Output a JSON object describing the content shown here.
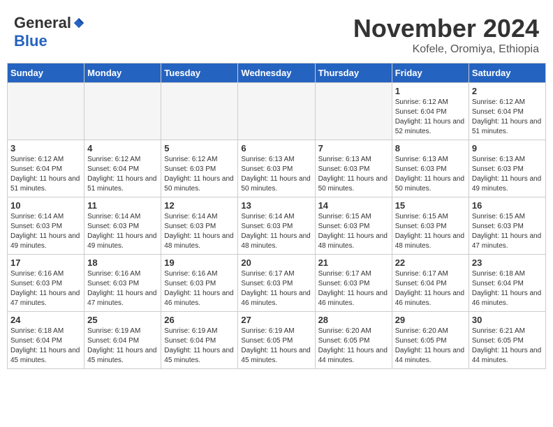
{
  "header": {
    "logo_general": "General",
    "logo_blue": "Blue",
    "month_title": "November 2024",
    "location": "Kofele, Oromiya, Ethiopia"
  },
  "calendar": {
    "weekdays": [
      "Sunday",
      "Monday",
      "Tuesday",
      "Wednesday",
      "Thursday",
      "Friday",
      "Saturday"
    ],
    "weeks": [
      [
        {
          "day": "",
          "empty": true
        },
        {
          "day": "",
          "empty": true
        },
        {
          "day": "",
          "empty": true
        },
        {
          "day": "",
          "empty": true
        },
        {
          "day": "",
          "empty": true
        },
        {
          "day": "1",
          "sunrise": "Sunrise: 6:12 AM",
          "sunset": "Sunset: 6:04 PM",
          "daylight": "Daylight: 11 hours and 52 minutes."
        },
        {
          "day": "2",
          "sunrise": "Sunrise: 6:12 AM",
          "sunset": "Sunset: 6:04 PM",
          "daylight": "Daylight: 11 hours and 51 minutes."
        }
      ],
      [
        {
          "day": "3",
          "sunrise": "Sunrise: 6:12 AM",
          "sunset": "Sunset: 6:04 PM",
          "daylight": "Daylight: 11 hours and 51 minutes."
        },
        {
          "day": "4",
          "sunrise": "Sunrise: 6:12 AM",
          "sunset": "Sunset: 6:04 PM",
          "daylight": "Daylight: 11 hours and 51 minutes."
        },
        {
          "day": "5",
          "sunrise": "Sunrise: 6:12 AM",
          "sunset": "Sunset: 6:03 PM",
          "daylight": "Daylight: 11 hours and 50 minutes."
        },
        {
          "day": "6",
          "sunrise": "Sunrise: 6:13 AM",
          "sunset": "Sunset: 6:03 PM",
          "daylight": "Daylight: 11 hours and 50 minutes."
        },
        {
          "day": "7",
          "sunrise": "Sunrise: 6:13 AM",
          "sunset": "Sunset: 6:03 PM",
          "daylight": "Daylight: 11 hours and 50 minutes."
        },
        {
          "day": "8",
          "sunrise": "Sunrise: 6:13 AM",
          "sunset": "Sunset: 6:03 PM",
          "daylight": "Daylight: 11 hours and 50 minutes."
        },
        {
          "day": "9",
          "sunrise": "Sunrise: 6:13 AM",
          "sunset": "Sunset: 6:03 PM",
          "daylight": "Daylight: 11 hours and 49 minutes."
        }
      ],
      [
        {
          "day": "10",
          "sunrise": "Sunrise: 6:14 AM",
          "sunset": "Sunset: 6:03 PM",
          "daylight": "Daylight: 11 hours and 49 minutes."
        },
        {
          "day": "11",
          "sunrise": "Sunrise: 6:14 AM",
          "sunset": "Sunset: 6:03 PM",
          "daylight": "Daylight: 11 hours and 49 minutes."
        },
        {
          "day": "12",
          "sunrise": "Sunrise: 6:14 AM",
          "sunset": "Sunset: 6:03 PM",
          "daylight": "Daylight: 11 hours and 48 minutes."
        },
        {
          "day": "13",
          "sunrise": "Sunrise: 6:14 AM",
          "sunset": "Sunset: 6:03 PM",
          "daylight": "Daylight: 11 hours and 48 minutes."
        },
        {
          "day": "14",
          "sunrise": "Sunrise: 6:15 AM",
          "sunset": "Sunset: 6:03 PM",
          "daylight": "Daylight: 11 hours and 48 minutes."
        },
        {
          "day": "15",
          "sunrise": "Sunrise: 6:15 AM",
          "sunset": "Sunset: 6:03 PM",
          "daylight": "Daylight: 11 hours and 48 minutes."
        },
        {
          "day": "16",
          "sunrise": "Sunrise: 6:15 AM",
          "sunset": "Sunset: 6:03 PM",
          "daylight": "Daylight: 11 hours and 47 minutes."
        }
      ],
      [
        {
          "day": "17",
          "sunrise": "Sunrise: 6:16 AM",
          "sunset": "Sunset: 6:03 PM",
          "daylight": "Daylight: 11 hours and 47 minutes."
        },
        {
          "day": "18",
          "sunrise": "Sunrise: 6:16 AM",
          "sunset": "Sunset: 6:03 PM",
          "daylight": "Daylight: 11 hours and 47 minutes."
        },
        {
          "day": "19",
          "sunrise": "Sunrise: 6:16 AM",
          "sunset": "Sunset: 6:03 PM",
          "daylight": "Daylight: 11 hours and 46 minutes."
        },
        {
          "day": "20",
          "sunrise": "Sunrise: 6:17 AM",
          "sunset": "Sunset: 6:03 PM",
          "daylight": "Daylight: 11 hours and 46 minutes."
        },
        {
          "day": "21",
          "sunrise": "Sunrise: 6:17 AM",
          "sunset": "Sunset: 6:03 PM",
          "daylight": "Daylight: 11 hours and 46 minutes."
        },
        {
          "day": "22",
          "sunrise": "Sunrise: 6:17 AM",
          "sunset": "Sunset: 6:04 PM",
          "daylight": "Daylight: 11 hours and 46 minutes."
        },
        {
          "day": "23",
          "sunrise": "Sunrise: 6:18 AM",
          "sunset": "Sunset: 6:04 PM",
          "daylight": "Daylight: 11 hours and 46 minutes."
        }
      ],
      [
        {
          "day": "24",
          "sunrise": "Sunrise: 6:18 AM",
          "sunset": "Sunset: 6:04 PM",
          "daylight": "Daylight: 11 hours and 45 minutes."
        },
        {
          "day": "25",
          "sunrise": "Sunrise: 6:19 AM",
          "sunset": "Sunset: 6:04 PM",
          "daylight": "Daylight: 11 hours and 45 minutes."
        },
        {
          "day": "26",
          "sunrise": "Sunrise: 6:19 AM",
          "sunset": "Sunset: 6:04 PM",
          "daylight": "Daylight: 11 hours and 45 minutes."
        },
        {
          "day": "27",
          "sunrise": "Sunrise: 6:19 AM",
          "sunset": "Sunset: 6:05 PM",
          "daylight": "Daylight: 11 hours and 45 minutes."
        },
        {
          "day": "28",
          "sunrise": "Sunrise: 6:20 AM",
          "sunset": "Sunset: 6:05 PM",
          "daylight": "Daylight: 11 hours and 44 minutes."
        },
        {
          "day": "29",
          "sunrise": "Sunrise: 6:20 AM",
          "sunset": "Sunset: 6:05 PM",
          "daylight": "Daylight: 11 hours and 44 minutes."
        },
        {
          "day": "30",
          "sunrise": "Sunrise: 6:21 AM",
          "sunset": "Sunset: 6:05 PM",
          "daylight": "Daylight: 11 hours and 44 minutes."
        }
      ]
    ]
  }
}
